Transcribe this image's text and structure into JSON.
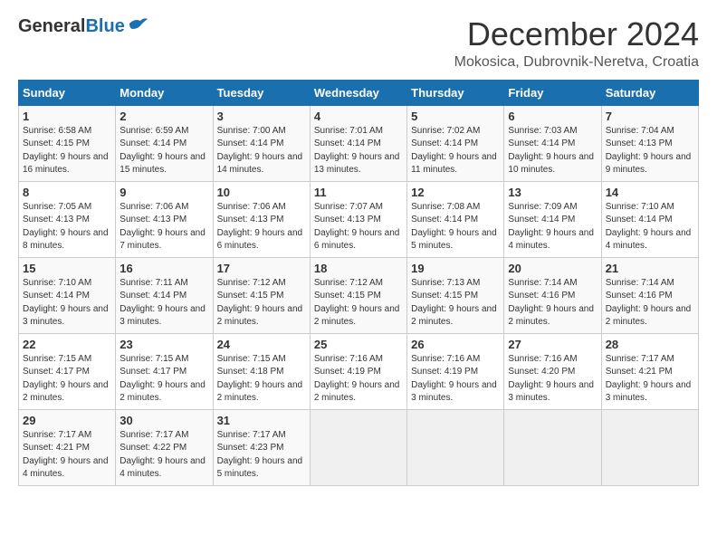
{
  "header": {
    "logo_general": "General",
    "logo_blue": "Blue",
    "month_title": "December 2024",
    "location": "Mokosica, Dubrovnik-Neretva, Croatia"
  },
  "columns": [
    "Sunday",
    "Monday",
    "Tuesday",
    "Wednesday",
    "Thursday",
    "Friday",
    "Saturday"
  ],
  "weeks": [
    [
      {
        "day": "1",
        "sunrise": "6:58 AM",
        "sunset": "4:15 PM",
        "daylight": "9 hours and 16 minutes."
      },
      {
        "day": "2",
        "sunrise": "6:59 AM",
        "sunset": "4:14 PM",
        "daylight": "9 hours and 15 minutes."
      },
      {
        "day": "3",
        "sunrise": "7:00 AM",
        "sunset": "4:14 PM",
        "daylight": "9 hours and 14 minutes."
      },
      {
        "day": "4",
        "sunrise": "7:01 AM",
        "sunset": "4:14 PM",
        "daylight": "9 hours and 13 minutes."
      },
      {
        "day": "5",
        "sunrise": "7:02 AM",
        "sunset": "4:14 PM",
        "daylight": "9 hours and 11 minutes."
      },
      {
        "day": "6",
        "sunrise": "7:03 AM",
        "sunset": "4:14 PM",
        "daylight": "9 hours and 10 minutes."
      },
      {
        "day": "7",
        "sunrise": "7:04 AM",
        "sunset": "4:13 PM",
        "daylight": "9 hours and 9 minutes."
      }
    ],
    [
      {
        "day": "8",
        "sunrise": "7:05 AM",
        "sunset": "4:13 PM",
        "daylight": "9 hours and 8 minutes."
      },
      {
        "day": "9",
        "sunrise": "7:06 AM",
        "sunset": "4:13 PM",
        "daylight": "9 hours and 7 minutes."
      },
      {
        "day": "10",
        "sunrise": "7:06 AM",
        "sunset": "4:13 PM",
        "daylight": "9 hours and 6 minutes."
      },
      {
        "day": "11",
        "sunrise": "7:07 AM",
        "sunset": "4:13 PM",
        "daylight": "9 hours and 6 minutes."
      },
      {
        "day": "12",
        "sunrise": "7:08 AM",
        "sunset": "4:14 PM",
        "daylight": "9 hours and 5 minutes."
      },
      {
        "day": "13",
        "sunrise": "7:09 AM",
        "sunset": "4:14 PM",
        "daylight": "9 hours and 4 minutes."
      },
      {
        "day": "14",
        "sunrise": "7:10 AM",
        "sunset": "4:14 PM",
        "daylight": "9 hours and 4 minutes."
      }
    ],
    [
      {
        "day": "15",
        "sunrise": "7:10 AM",
        "sunset": "4:14 PM",
        "daylight": "9 hours and 3 minutes."
      },
      {
        "day": "16",
        "sunrise": "7:11 AM",
        "sunset": "4:14 PM",
        "daylight": "9 hours and 3 minutes."
      },
      {
        "day": "17",
        "sunrise": "7:12 AM",
        "sunset": "4:15 PM",
        "daylight": "9 hours and 2 minutes."
      },
      {
        "day": "18",
        "sunrise": "7:12 AM",
        "sunset": "4:15 PM",
        "daylight": "9 hours and 2 minutes."
      },
      {
        "day": "19",
        "sunrise": "7:13 AM",
        "sunset": "4:15 PM",
        "daylight": "9 hours and 2 minutes."
      },
      {
        "day": "20",
        "sunrise": "7:14 AM",
        "sunset": "4:16 PM",
        "daylight": "9 hours and 2 minutes."
      },
      {
        "day": "21",
        "sunrise": "7:14 AM",
        "sunset": "4:16 PM",
        "daylight": "9 hours and 2 minutes."
      }
    ],
    [
      {
        "day": "22",
        "sunrise": "7:15 AM",
        "sunset": "4:17 PM",
        "daylight": "9 hours and 2 minutes."
      },
      {
        "day": "23",
        "sunrise": "7:15 AM",
        "sunset": "4:17 PM",
        "daylight": "9 hours and 2 minutes."
      },
      {
        "day": "24",
        "sunrise": "7:15 AM",
        "sunset": "4:18 PM",
        "daylight": "9 hours and 2 minutes."
      },
      {
        "day": "25",
        "sunrise": "7:16 AM",
        "sunset": "4:19 PM",
        "daylight": "9 hours and 2 minutes."
      },
      {
        "day": "26",
        "sunrise": "7:16 AM",
        "sunset": "4:19 PM",
        "daylight": "9 hours and 3 minutes."
      },
      {
        "day": "27",
        "sunrise": "7:16 AM",
        "sunset": "4:20 PM",
        "daylight": "9 hours and 3 minutes."
      },
      {
        "day": "28",
        "sunrise": "7:17 AM",
        "sunset": "4:21 PM",
        "daylight": "9 hours and 3 minutes."
      }
    ],
    [
      {
        "day": "29",
        "sunrise": "7:17 AM",
        "sunset": "4:21 PM",
        "daylight": "9 hours and 4 minutes."
      },
      {
        "day": "30",
        "sunrise": "7:17 AM",
        "sunset": "4:22 PM",
        "daylight": "9 hours and 4 minutes."
      },
      {
        "day": "31",
        "sunrise": "7:17 AM",
        "sunset": "4:23 PM",
        "daylight": "9 hours and 5 minutes."
      },
      null,
      null,
      null,
      null
    ]
  ]
}
